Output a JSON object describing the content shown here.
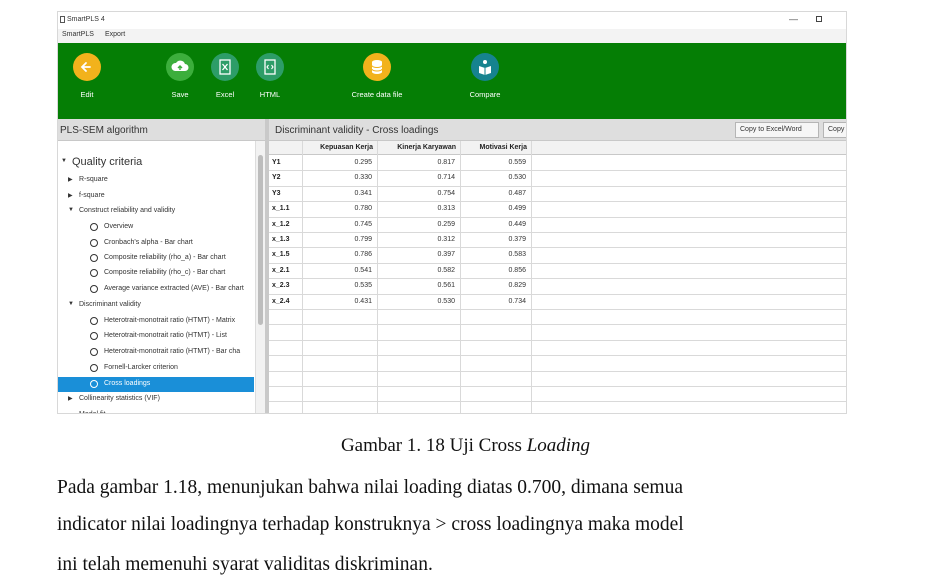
{
  "window": {
    "title": "SmartPLS 4",
    "minimize_glyph": "—"
  },
  "menu": [
    "SmartPLS",
    "Export"
  ],
  "toolbar": {
    "items": [
      {
        "label": "Edit",
        "icon": "back-arrow-icon",
        "color": "#f2b21c"
      },
      {
        "label": "Save",
        "icon": "cloud-upload-icon",
        "color": "#3cae3c"
      },
      {
        "label": "Excel",
        "icon": "excel-file-icon",
        "color": "#2d9d68"
      },
      {
        "label": "HTML",
        "icon": "html-file-icon",
        "color": "#2d9d68"
      },
      {
        "label": "Create data file",
        "icon": "database-icon",
        "color": "#f2b21c"
      },
      {
        "label": "Compare",
        "icon": "compare-icon",
        "color": "#16838f"
      }
    ]
  },
  "left_panel": {
    "title": "PLS-SEM algorithm",
    "items": [
      {
        "label": "Quality criteria",
        "kind": "expanded"
      },
      {
        "label": "R-square",
        "kind": "collapsed"
      },
      {
        "label": "f-square",
        "kind": "collapsed"
      },
      {
        "label": "Construct reliability and validity",
        "kind": "expanded"
      },
      {
        "label": "Overview",
        "kind": "radio"
      },
      {
        "label": "Cronbach's alpha - Bar chart",
        "kind": "radio"
      },
      {
        "label": "Composite reliability (rho_a) - Bar chart",
        "kind": "radio"
      },
      {
        "label": "Composite reliability (rho_c) - Bar chart",
        "kind": "radio"
      },
      {
        "label": "Average variance extracted (AVE) - Bar chart",
        "kind": "radio"
      },
      {
        "label": "Discriminant validity",
        "kind": "expanded"
      },
      {
        "label": "Heterotrait-monotrait ratio (HTMT) - Matrix",
        "kind": "radio"
      },
      {
        "label": "Heterotrait-monotrait ratio (HTMT) - List",
        "kind": "radio"
      },
      {
        "label": "Heterotrait-monotrait ratio (HTMT) - Bar cha",
        "kind": "radio"
      },
      {
        "label": "Fornell-Larcker criterion",
        "kind": "radio"
      },
      {
        "label": "Cross loadings",
        "kind": "radio",
        "selected": true
      },
      {
        "label": "Collinearity statistics (VIF)",
        "kind": "collapsed"
      },
      {
        "label": "Model fit",
        "kind": "plain"
      }
    ]
  },
  "right_panel": {
    "title": "Discriminant validity - Cross loadings",
    "buttons": [
      "Copy to Excel/Word",
      "Copy to"
    ],
    "columns": [
      "Kepuasan Kerja",
      "Kinerja Karyawan",
      "Motivasi Kerja"
    ],
    "rows": [
      {
        "name": "Y1",
        "values": [
          "0.295",
          "0.817",
          "0.559"
        ]
      },
      {
        "name": "Y2",
        "values": [
          "0.330",
          "0.714",
          "0.530"
        ]
      },
      {
        "name": "Y3",
        "values": [
          "0.341",
          "0.754",
          "0.487"
        ]
      },
      {
        "name": "x_1.1",
        "values": [
          "0.780",
          "0.313",
          "0.499"
        ]
      },
      {
        "name": "x_1.2",
        "values": [
          "0.745",
          "0.259",
          "0.449"
        ]
      },
      {
        "name": "x_1.3",
        "values": [
          "0.799",
          "0.312",
          "0.379"
        ]
      },
      {
        "name": "x_1.5",
        "values": [
          "0.786",
          "0.397",
          "0.583"
        ]
      },
      {
        "name": "x_2.1",
        "values": [
          "0.541",
          "0.582",
          "0.856"
        ]
      },
      {
        "name": "x_2.3",
        "values": [
          "0.535",
          "0.561",
          "0.829"
        ]
      },
      {
        "name": "x_2.4",
        "values": [
          "0.431",
          "0.530",
          "0.734"
        ]
      }
    ]
  },
  "caption": {
    "prefix": "Gambar 1.  18 Uji Cross ",
    "italic": "Loading"
  },
  "paragraph": [
    "Pada gambar 1.18, menunjukan bahwa nilai loading diatas 0.700, dimana semua",
    "indicator nilai loadingnya terhadap konstruknya > cross loadingnya maka model",
    "ini telah memenuhi syarat validitas diskriminan."
  ]
}
